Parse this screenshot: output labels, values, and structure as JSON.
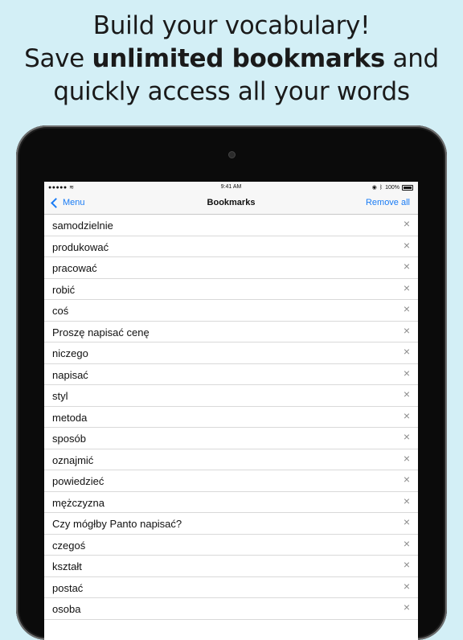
{
  "headline": {
    "line1": "Build your vocabulary!",
    "line2_pre": "Save ",
    "line2_bold": "unlimited bookmarks",
    "line2_post": " and",
    "line3": "quickly access all your words"
  },
  "status": {
    "signal": "●●●●● ",
    "time": "9:41 AM",
    "battery": "100%"
  },
  "nav": {
    "back_label": "Menu",
    "title": "Bookmarks",
    "remove_all_label": "Remove all"
  },
  "bookmarks": [
    "samodzielnie",
    "produkować",
    "pracować",
    "robić",
    "coś",
    "Proszę napisać cenę",
    "niczego",
    "napisać",
    "styl",
    "metoda",
    "sposób",
    "oznajmić",
    "powiedzieć",
    "mężczyzna",
    "Czy mógłby Panto napisać?",
    "czegoś",
    "kształt",
    "postać",
    "osoba"
  ],
  "icons": {
    "delete": "×",
    "wifi": "wifi-icon",
    "bluetooth": "bluetooth-icon",
    "location": "location-icon"
  }
}
